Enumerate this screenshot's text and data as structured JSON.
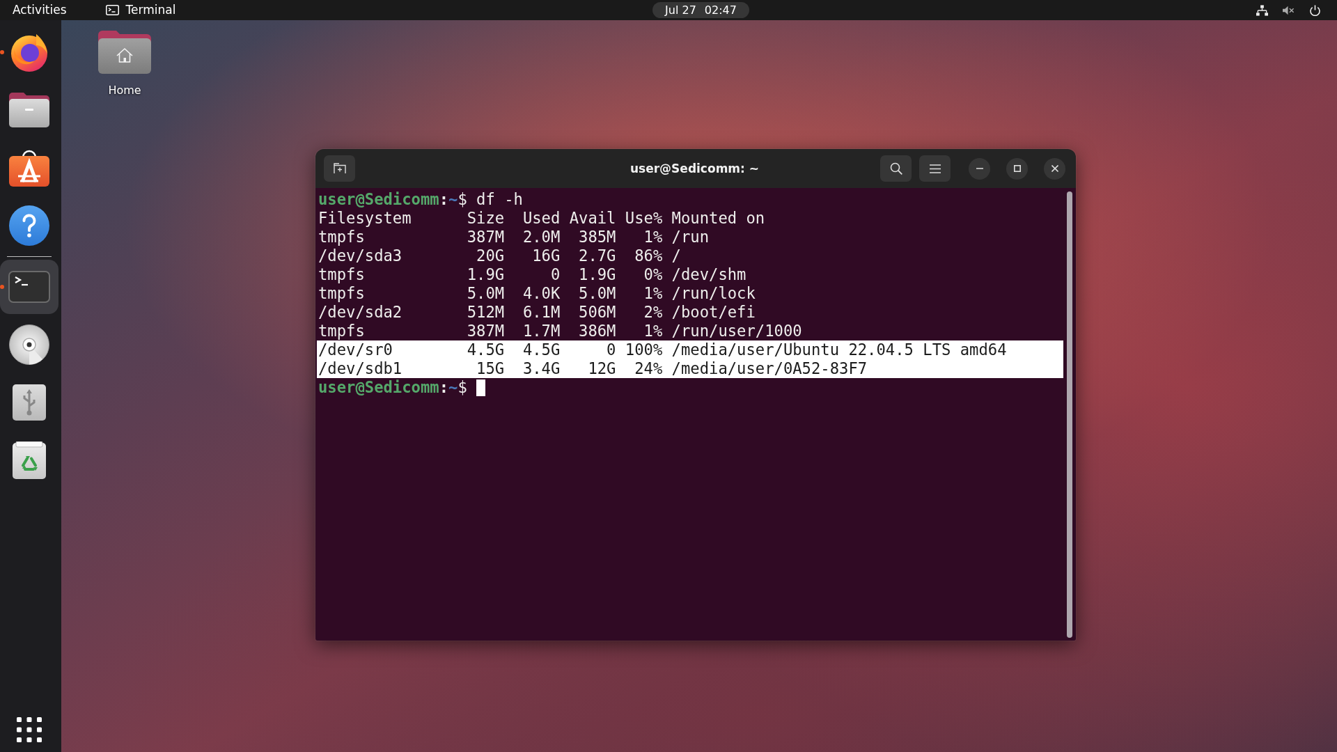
{
  "top_bar": {
    "activities": "Activities",
    "app_menu": "Terminal",
    "clock": {
      "date": "Jul 27",
      "time": "02:47"
    },
    "volume_muted": true
  },
  "dock": {
    "favorites": [
      {
        "kind": "browser",
        "running": true,
        "focused": false
      },
      {
        "kind": "files",
        "running": false,
        "focused": false
      },
      {
        "kind": "software",
        "running": false,
        "focused": false
      },
      {
        "kind": "help",
        "running": false,
        "focused": false
      }
    ],
    "others": [
      {
        "kind": "terminal",
        "running": true,
        "focused": true
      },
      {
        "kind": "disc",
        "running": false,
        "focused": false
      },
      {
        "kind": "usb",
        "running": false,
        "focused": false
      },
      {
        "kind": "trash",
        "running": false,
        "focused": false
      }
    ]
  },
  "desktop": {
    "icons": [
      {
        "label": "Home"
      }
    ]
  },
  "terminal": {
    "title": "user@Sedicomm: ~",
    "lines": [
      {
        "kind": "prompt",
        "user_host": "user@Sedicomm",
        "separator": ":",
        "path": "~",
        "symbol": "$",
        "command": "df -h",
        "cursor": false,
        "selected": false
      },
      {
        "kind": "output",
        "text": "Filesystem      Size  Used Avail Use% Mounted on",
        "selected": false
      },
      {
        "kind": "output",
        "text": "tmpfs           387M  2.0M  385M   1% /run",
        "selected": false
      },
      {
        "kind": "output",
        "text": "/dev/sda3        20G   16G  2.7G  86% /",
        "selected": false
      },
      {
        "kind": "output",
        "text": "tmpfs           1.9G     0  1.9G   0% /dev/shm",
        "selected": false
      },
      {
        "kind": "output",
        "text": "tmpfs           5.0M  4.0K  5.0M   1% /run/lock",
        "selected": false
      },
      {
        "kind": "output",
        "text": "/dev/sda2       512M  6.1M  506M   2% /boot/efi",
        "selected": false
      },
      {
        "kind": "output",
        "text": "tmpfs           387M  1.7M  386M   1% /run/user/1000",
        "selected": false
      },
      {
        "kind": "output",
        "text": "/dev/sr0        4.5G  4.5G     0 100% /media/user/Ubuntu 22.04.5 LTS amd64",
        "selected": true
      },
      {
        "kind": "output",
        "text": "/dev/sdb1        15G  3.4G   12G  24% /media/user/0A52-83F7",
        "selected": true
      },
      {
        "kind": "prompt",
        "user_host": "user@Sedicomm",
        "separator": ":",
        "path": "~",
        "symbol": "$",
        "cursor": true,
        "selected": false
      }
    ]
  }
}
